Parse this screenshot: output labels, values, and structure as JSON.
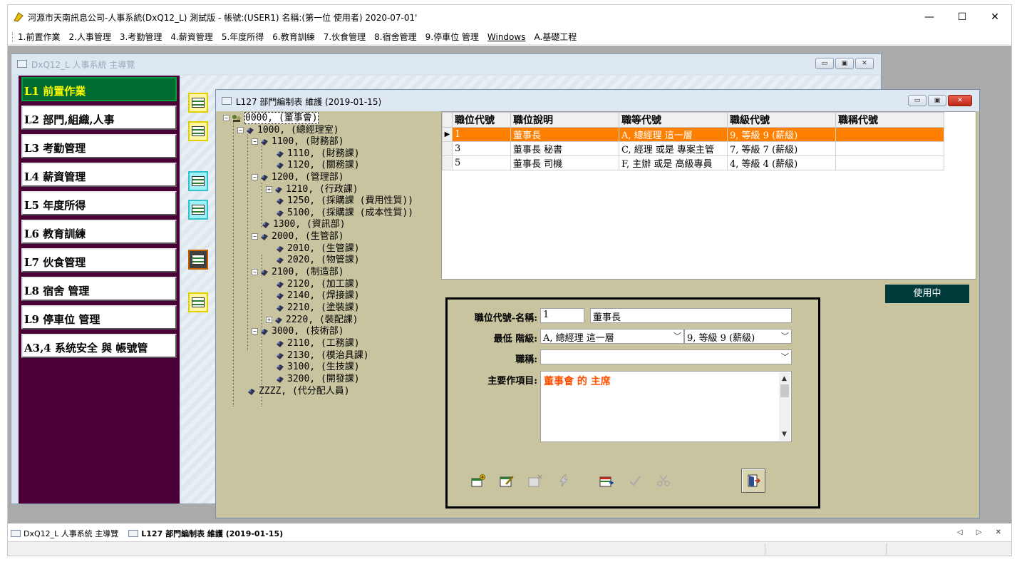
{
  "window": {
    "title": "河源市天南訊息公司-人事系統(DxQ12_L) 測試版 - 帳號:(USER1) 名稱:(第一位 使用者) 2020-07-01'",
    "controls": [
      "—",
      "☐",
      "✕"
    ]
  },
  "menu": [
    "1.前置作業",
    "2.人事管理",
    "3.考勤管理",
    "4.薪資管理",
    "5.年度所得",
    "6.教育訓練",
    "7.伙食管理",
    "8.宿舍管理",
    "9.停車位 管理",
    "Windows",
    "A.基礎工程"
  ],
  "main_window": {
    "title": "DxQ12_L 人事系統 主導覽",
    "nav": [
      "L1  前置作業",
      "L2  部門,組織,人事",
      "L3  考勤管理",
      "L4  薪資管理",
      "L5  年度所得",
      "L6  教育訓練",
      "L7  伙食管理",
      "L8  宿舍 管理",
      "L9  停車位 管理",
      "A3,4  系统安全 與 帳號管"
    ]
  },
  "child_window": {
    "title": "L127 部門編制表 維護 (2019-01-15)",
    "tree": [
      {
        "text": "0000, (董事會)",
        "level": 0
      },
      {
        "text": "1000, (總經理室)",
        "level": 1
      },
      {
        "text": "1100, (財務部)",
        "level": 2
      },
      {
        "text": "1110, (財務課)",
        "level": 3
      },
      {
        "text": "1120, (關務課)",
        "level": 3
      },
      {
        "text": "1200, (管理部)",
        "level": 2
      },
      {
        "text": "1210, (行政課)",
        "level": 3
      },
      {
        "text": "1250, (採購課 (費用性質))",
        "level": 3
      },
      {
        "text": "5100, (採購課 (成本性質))",
        "level": 3
      },
      {
        "text": "1300, (資訊部)",
        "level": 2
      },
      {
        "text": "2000, (生管部)",
        "level": 2
      },
      {
        "text": "2010, (生管課)",
        "level": 3
      },
      {
        "text": "2020, (物管課)",
        "level": 3
      },
      {
        "text": "2100, (制造部)",
        "level": 2
      },
      {
        "text": "2120, (加工課)",
        "level": 3
      },
      {
        "text": "2140, (焊接課)",
        "level": 3
      },
      {
        "text": "2210, (塗裝課)",
        "level": 3
      },
      {
        "text": "2220, (裝配課)",
        "level": 3
      },
      {
        "text": "3000, (技術部)",
        "level": 2
      },
      {
        "text": "2110, (工務課)",
        "level": 3
      },
      {
        "text": "2130, (模治具課)",
        "level": 3
      },
      {
        "text": "3100, (生技課)",
        "level": 3
      },
      {
        "text": "3200, (開發課)",
        "level": 3
      },
      {
        "text": "ZZZZ, (代分配人員)",
        "level": 1
      }
    ],
    "grid": {
      "columns": [
        "職位代號",
        "職位說明",
        "職等代號",
        "職級代號",
        "職稱代號"
      ],
      "rows": [
        [
          "1",
          "董事長",
          "A, 總經理 這一層",
          "9, 等級 9 (薪級)",
          ""
        ],
        [
          "3",
          "董事長 秘書",
          "C, 經理 或是 專案主管",
          "7, 等級 7 (薪級)",
          ""
        ],
        [
          "5",
          "董事長 司機",
          "F, 主辦  或是  高級專員",
          "4, 等級 4 (薪級)",
          ""
        ]
      ],
      "row_indicator": "▶"
    },
    "status_badge": "使用中",
    "form": {
      "code_label": "職位代號-名稱:",
      "code_value": "1",
      "name_value": "董事長",
      "grade_label": "最低 階級:",
      "grade_value": "A, 總經理 這一層",
      "level_value": "9, 等級 9 (薪級)",
      "title_label": "職稱:",
      "title_value": "",
      "duty_label": "主要作項目:",
      "duty_value": "董事會 的 主席"
    }
  },
  "taskbar": {
    "tabs": [
      "DxQ12_L 人事系統 主導覽",
      "L127 部門編制表 維護 (2019-01-15)"
    ],
    "nav": "◁ ▷ ✕"
  },
  "colors": {
    "nav_panel": "#4a0036",
    "nav_active": "#006b2e",
    "nav_active_text": "#ffff00",
    "grid_selected": "#ff7f00",
    "form_bg": "#c8c4a0",
    "badge": "#003a3a",
    "duty_text": "#ff5000"
  }
}
